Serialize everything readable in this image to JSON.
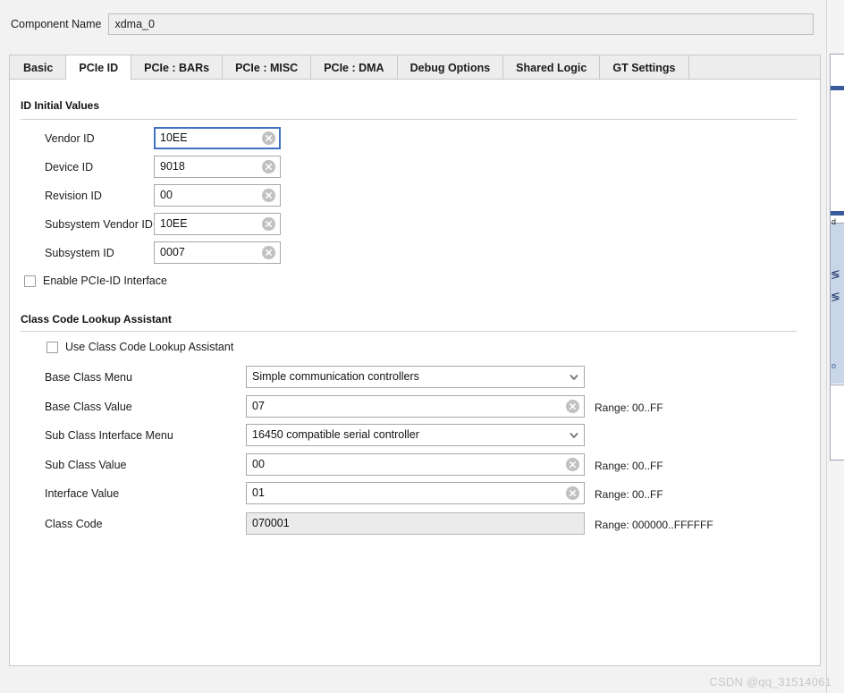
{
  "component": {
    "label": "Component Name",
    "value": "xdma_0"
  },
  "tabs": [
    {
      "label": "Basic",
      "active": false
    },
    {
      "label": "PCIe ID",
      "active": true
    },
    {
      "label": "PCIe : BARs",
      "active": false
    },
    {
      "label": "PCIe : MISC",
      "active": false
    },
    {
      "label": "PCIe : DMA",
      "active": false
    },
    {
      "label": "Debug Options",
      "active": false
    },
    {
      "label": "Shared Logic",
      "active": false
    },
    {
      "label": "GT Settings",
      "active": false
    }
  ],
  "id_initial_values": {
    "title": "ID Initial Values",
    "fields": [
      {
        "label": "Vendor ID",
        "value": "10EE",
        "focused": true,
        "clear": true
      },
      {
        "label": "Device ID",
        "value": "9018",
        "focused": false,
        "clear": true
      },
      {
        "label": "Revision ID",
        "value": "00",
        "focused": false,
        "clear": true
      },
      {
        "label": "Subsystem Vendor ID",
        "value": "10EE",
        "focused": false,
        "clear": true
      },
      {
        "label": "Subsystem ID",
        "value": "0007",
        "focused": false,
        "clear": true
      }
    ],
    "enable_pcie_id_interface": {
      "label": "Enable PCIe-ID Interface",
      "checked": false
    }
  },
  "class_code_lookup_assistant": {
    "title": "Class Code Lookup Assistant",
    "use_assistant": {
      "label": "Use Class Code Lookup Assistant",
      "checked": false
    },
    "base_class_menu": {
      "label": "Base Class Menu",
      "value": "Simple communication controllers"
    },
    "base_class_value": {
      "label": "Base Class Value",
      "value": "07",
      "range": "Range: 00..FF"
    },
    "sub_class_interface_menu": {
      "label": "Sub Class Interface Menu",
      "value": "16450 compatible serial controller"
    },
    "sub_class_value": {
      "label": "Sub Class Value",
      "value": "00",
      "range": "Range: 00..FF"
    },
    "interface_value": {
      "label": "Interface Value",
      "value": "01",
      "range": "Range: 00..FF"
    },
    "class_code": {
      "label": "Class Code",
      "value": "070001",
      "range": "Range: 000000..FFFFFF",
      "readonly": true
    }
  },
  "background_window": {
    "glyph_1": "≶",
    "glyph_2": "≶",
    "edge_text_1": "d",
    "edge_text_2": "o"
  },
  "watermark": "CSDN @qq_31514061",
  "colors": {
    "focus_border": "#3f72c4",
    "panel_bg": "#ffffff",
    "window_bg": "#f2f2f2",
    "tab_inactive": "#ededed",
    "clear_icon": "#c1c1c1"
  }
}
